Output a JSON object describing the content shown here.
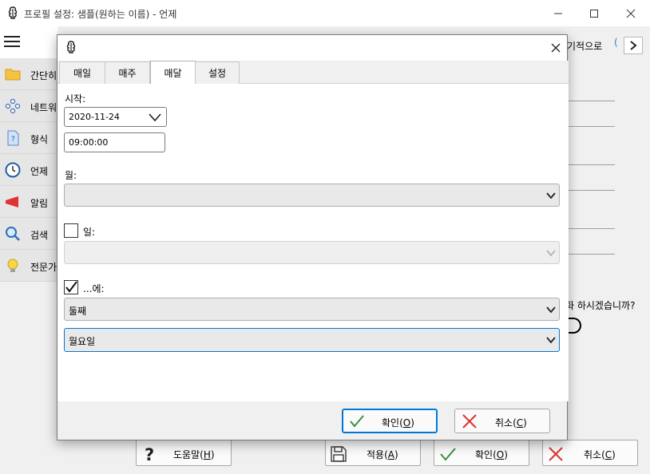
{
  "main_window": {
    "title": "프로필 설정: 샘플(원하는 이름) - 언제",
    "sidebar": {
      "items": [
        {
          "label": "간단히",
          "icon": "folder-icon"
        },
        {
          "label": "네트워",
          "icon": "network-icon"
        },
        {
          "label": "형식",
          "icon": "help-file-icon"
        },
        {
          "label": "언제",
          "icon": "clock-icon"
        },
        {
          "label": "알림",
          "icon": "megaphone-icon"
        },
        {
          "label": "검색",
          "icon": "magnifier-icon"
        },
        {
          "label": "전문가",
          "icon": "lightbulb-icon"
        }
      ]
    },
    "tab_strip_label": "기적으로",
    "tab_strip_left_glyph": "(",
    "question_text": "화 하시겠습니까?",
    "buttons": {
      "help": {
        "label": "도움말(",
        "mnemonic": "H",
        "suffix": ")"
      },
      "apply": {
        "label": "적용(",
        "mnemonic": "A",
        "suffix": ")"
      },
      "ok": {
        "label": "확인(",
        "mnemonic": "O",
        "suffix": ")"
      },
      "cancel": {
        "label": "취소(",
        "mnemonic": "C",
        "suffix": ")"
      }
    }
  },
  "dialog": {
    "tabs": [
      {
        "label": "매일",
        "active": false
      },
      {
        "label": "매주",
        "active": false
      },
      {
        "label": "매달",
        "active": true
      },
      {
        "label": "설정",
        "active": false
      }
    ],
    "start_label": "시작:",
    "start_date": "2020-11-24",
    "start_time": "09:00:00",
    "month_label": "월:",
    "month_value": "",
    "day_checked": false,
    "day_label": "일:",
    "day_value": "",
    "on_checked": true,
    "on_label": "...에:",
    "ordinal_value": "둘째",
    "weekday_value": "월요일",
    "ok_button": {
      "label": "확인(",
      "mnemonic": "O",
      "suffix": ")"
    },
    "cancel_button": {
      "label": "취소(",
      "mnemonic": "C",
      "suffix": ")"
    }
  },
  "colors": {
    "accent": "#0078d7",
    "ok_green": "#3a8f3a",
    "cancel_red": "#e0322f"
  }
}
